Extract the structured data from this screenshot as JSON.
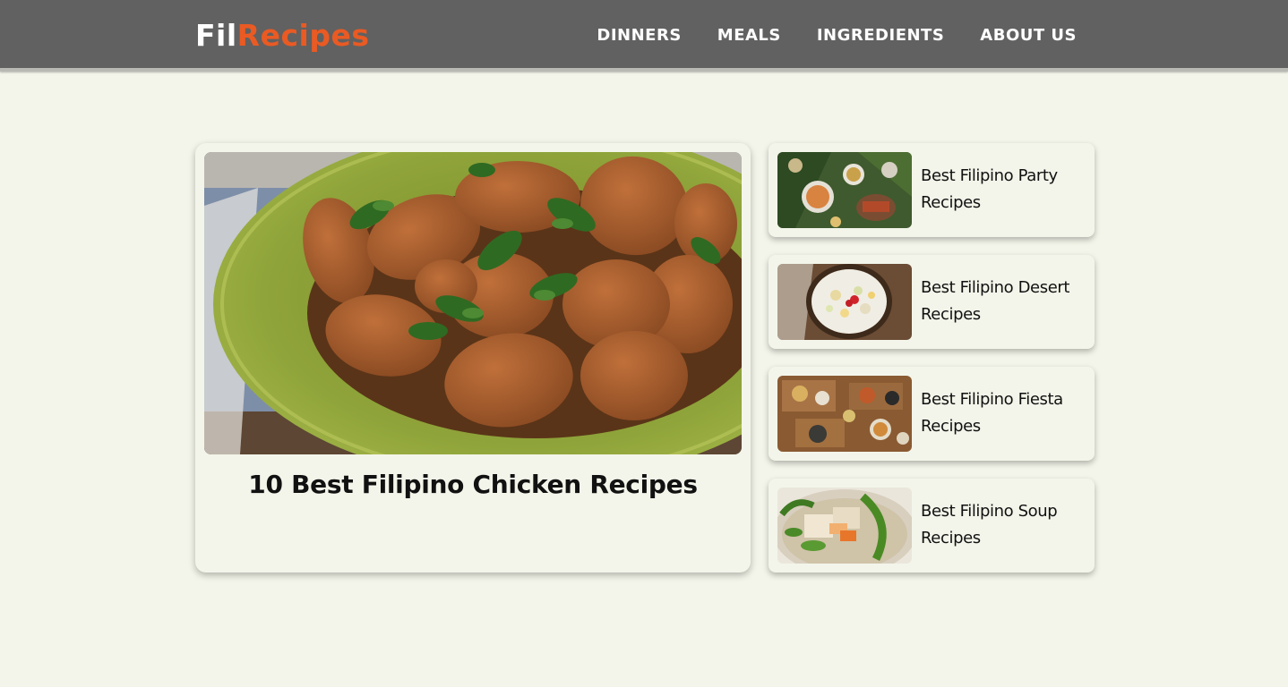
{
  "brand": {
    "name_part1": "Fil",
    "name_part2": "Recipes",
    "colors": {
      "header_bg": "#616161",
      "accent": "#ea5a23",
      "page_bg": "#f3f5ea"
    }
  },
  "nav": {
    "items": [
      {
        "label": "DINNERS"
      },
      {
        "label": "MEALS"
      },
      {
        "label": "INGREDIENTS"
      },
      {
        "label": "ABOUT US"
      }
    ]
  },
  "featured": {
    "title": "10 Best Filipino Chicken Recipes",
    "image_icon": "chicken-adobo-photo"
  },
  "sidebar": {
    "items": [
      {
        "label": "Best Filipino Party Recipes",
        "image_icon": "party-food-photo"
      },
      {
        "label": "Best Filipino Desert Recipes",
        "image_icon": "fruit-salad-photo"
      },
      {
        "label": "Best Filipino Fiesta Recipes",
        "image_icon": "fiesta-spread-photo"
      },
      {
        "label": "Best Filipino Soup Recipes",
        "image_icon": "sinigang-soup-photo"
      }
    ]
  }
}
